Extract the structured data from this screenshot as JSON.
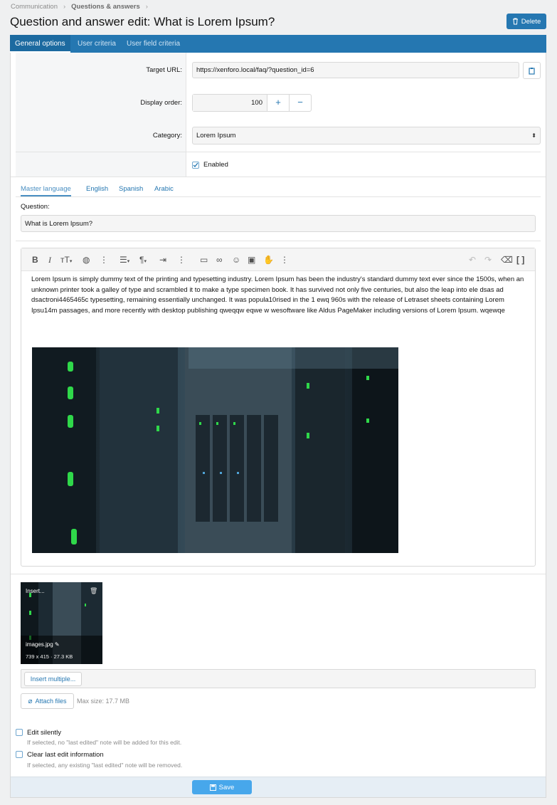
{
  "breadcrumb": [
    "Communication",
    "Questions & answers"
  ],
  "page_title": "Question and answer edit: What is Lorem Ipsum?",
  "delete_label": "Delete",
  "tabs": [
    {
      "label": "General options",
      "active": true
    },
    {
      "label": "User criteria",
      "active": false
    },
    {
      "label": "User field criteria",
      "active": false
    }
  ],
  "form": {
    "target_url_label": "Target URL:",
    "target_url_value": "https://xenforo.local/faq/?question_id=6",
    "display_order_label": "Display order:",
    "display_order_value": "100",
    "plus": "+",
    "minus": "−",
    "category_label": "Category:",
    "category_value": "Lorem Ipsum",
    "enabled_label": "Enabled",
    "enabled_checked": true
  },
  "language_tabs": [
    {
      "label": "Master language",
      "active": true
    },
    {
      "label": "English",
      "active": false
    },
    {
      "label": "Spanish",
      "active": false
    },
    {
      "label": "Arabic",
      "active": false
    }
  ],
  "question_label": "Question:",
  "question_value": "What is Lorem Ipsum?",
  "editor_text": "Lorem Ipsum is simply dummy text of the printing and typesetting industry. Lorem Ipsum has been the industry's standard dummy text ever since the 1500s, when an unknown printer took a galley of type and scrambled it to make a type specimen book. It has survived not only five centuries, but also the leap into ele dsas ad dsactroni4465465c typesetting, remaining essentially unchanged. It was popula10rised in the 1 ewq 960s with the release of Letraset sheets containing Lorem Ipsu14m passages, and more recently with desktop publishing  qweqqw eqwe w wesoftware like Aldus PageMaker including versions of Lorem Ipsum. wqewqe",
  "attachment": {
    "insert_label": "Insert...",
    "filename": "images.jpg",
    "meta": "739 x 415 · 27.3 KB"
  },
  "insert_multiple_label": "Insert multiple...",
  "attach_files_label": "Attach files",
  "max_size": "Max size: 17.7 MB",
  "edit_silently_label": "Edit silently",
  "edit_silently_hint": "If selected, no \"last edited\" note will be added for this edit.",
  "clear_edit_label": "Clear last edit information",
  "clear_edit_hint": "If selected, any existing \"last edited\" note will be removed.",
  "save_label": "Save",
  "colors": {
    "accent": "#2577b1",
    "save": "#47a7eb"
  }
}
